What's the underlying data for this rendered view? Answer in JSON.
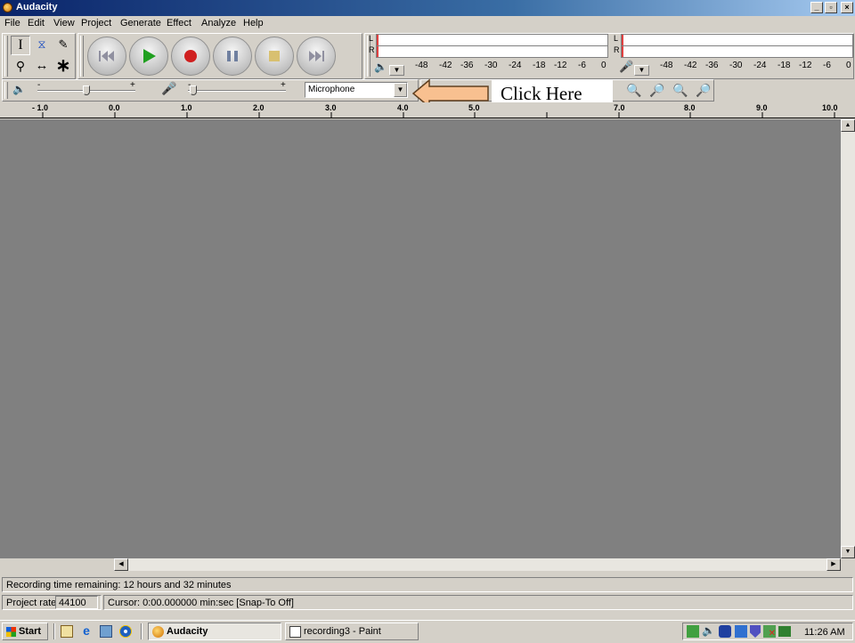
{
  "window": {
    "title": "Audacity"
  },
  "menu": [
    "File",
    "Edit",
    "View",
    "Project",
    "Generate",
    "Effect",
    "Analyze",
    "Help"
  ],
  "meter": {
    "lr_left": [
      "L",
      "R"
    ],
    "lr_right": [
      "L",
      "R"
    ],
    "scale_play": [
      "-48",
      "-42",
      "-36",
      "-30",
      "-24",
      "-18",
      "-12",
      "-6",
      "0"
    ],
    "scale_rec": [
      "-48",
      "-42",
      "-36",
      "-30",
      "-24",
      "-18",
      "-12",
      "-6",
      "0"
    ]
  },
  "mixer": {
    "out_minus": "-",
    "out_plus": "+",
    "in_minus": "-",
    "in_plus": "+",
    "output_volume_level": 0.5,
    "input_volume_level": 0.05,
    "input_source": "Microphone"
  },
  "callout": {
    "text": "Click Here"
  },
  "ruler": [
    "- 1.0",
    "0.0",
    "1.0",
    "2.0",
    "3.0",
    "4.0",
    "5.0",
    "7.0",
    "8.0",
    "9.0",
    "10.0"
  ],
  "status": {
    "recording_time": "Recording time remaining: 12 hours and 32 minutes",
    "project_rate_label": "Project rate:",
    "project_rate_value": "44100",
    "cursor": "Cursor: 0:00.000000 min:sec   [Snap-To Off]"
  },
  "taskbar": {
    "start": "Start",
    "tasks": [
      "Audacity",
      "recording3 - Paint"
    ],
    "clock": "11:26 AM"
  },
  "colors": {
    "title_start": "#0a246a",
    "track_bg": "#808080",
    "record_red": "#d02020",
    "play_green": "#20a020",
    "arrow_fill": "#f8c090"
  }
}
